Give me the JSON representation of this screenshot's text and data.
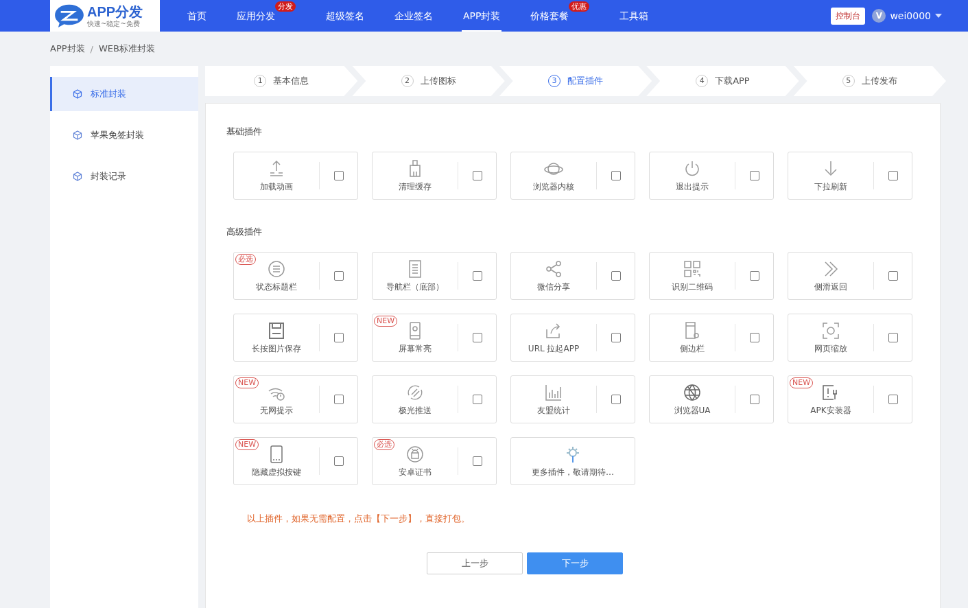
{
  "logo": {
    "title": "APP分发",
    "slogan": "快速~稳定~免费"
  },
  "nav": [
    {
      "label": "首页",
      "selected": false
    },
    {
      "label": "应用分发",
      "selected": false,
      "badge": "分发"
    },
    {
      "label": "超级签名",
      "selected": false
    },
    {
      "label": "企业签名",
      "selected": false
    },
    {
      "label": "APP封装",
      "selected": true
    },
    {
      "label": "价格套餐",
      "selected": false,
      "badge": "优惠"
    },
    {
      "label": "工具箱",
      "selected": false
    }
  ],
  "console_button": "控制台",
  "user": {
    "avatar_letter": "V",
    "name": "wei0000"
  },
  "breadcrumb": [
    "APP封装",
    "/",
    "WEB标准封装"
  ],
  "sidebar": [
    {
      "label": "标准封装",
      "selected": true
    },
    {
      "label": "苹果免签封装",
      "selected": false
    },
    {
      "label": "封装记录",
      "selected": false
    }
  ],
  "steps": [
    {
      "number": "1",
      "label": "基本信息",
      "selected": false
    },
    {
      "number": "2",
      "label": "上传图标",
      "selected": false
    },
    {
      "number": "3",
      "label": "配置插件",
      "selected": true
    },
    {
      "number": "4",
      "label": "下载APP",
      "selected": false
    },
    {
      "number": "5",
      "label": "上传发布",
      "selected": false
    }
  ],
  "sections": [
    {
      "title": "基础插件",
      "plugins": [
        {
          "kind": "plugin",
          "label": "加载动画",
          "checked": false
        },
        {
          "kind": "plugin",
          "label": "清理缓存",
          "checked": false
        },
        {
          "kind": "plugin",
          "label": "浏览器内核",
          "checked": false
        },
        {
          "kind": "plugin",
          "label": "退出提示",
          "checked": false
        },
        {
          "kind": "plugin",
          "label": "下拉刷新",
          "checked": false
        }
      ]
    },
    {
      "title": "高级插件",
      "plugins": [
        {
          "kind": "plugin",
          "label": "状态标题栏",
          "checked": false,
          "badge": "必选"
        },
        {
          "kind": "plugin",
          "label": "导航栏（底部）",
          "checked": false
        },
        {
          "kind": "plugin",
          "label": "微信分享",
          "checked": false
        },
        {
          "kind": "plugin",
          "label": "识别二维码",
          "checked": false
        },
        {
          "kind": "plugin",
          "label": "侧滑返回",
          "checked": false
        },
        {
          "kind": "plugin",
          "label": "长按图片保存",
          "checked": false
        },
        {
          "kind": "plugin",
          "label": "屏幕常亮",
          "checked": false,
          "badge": "NEW"
        },
        {
          "kind": "plugin",
          "label": "URL 拉起APP",
          "checked": false
        },
        {
          "kind": "plugin",
          "label": "侧边栏",
          "checked": false
        },
        {
          "kind": "plugin",
          "label": "网页缩放",
          "checked": false
        },
        {
          "kind": "plugin",
          "label": "无网提示",
          "checked": false,
          "badge": "NEW"
        },
        {
          "kind": "plugin",
          "label": "极光推送",
          "checked": false
        },
        {
          "kind": "plugin",
          "label": "友盟统计",
          "checked": false
        },
        {
          "kind": "plugin",
          "label": "浏览器UA",
          "checked": false
        },
        {
          "kind": "plugin",
          "label": "APK安装器",
          "checked": false,
          "badge": "NEW"
        },
        {
          "kind": "plugin",
          "label": "隐藏虚拟按键",
          "checked": false,
          "badge": "NEW"
        },
        {
          "kind": "plugin",
          "label": "安卓证书",
          "checked": false,
          "badge": "必选"
        },
        {
          "kind": "more",
          "label": "更多插件，敬请期待…"
        }
      ]
    }
  ],
  "hint": "以上插件，如果无需配置，点击【下一步】，直接打包。",
  "buttons": {
    "prev": "上一步",
    "next": "下一步"
  }
}
